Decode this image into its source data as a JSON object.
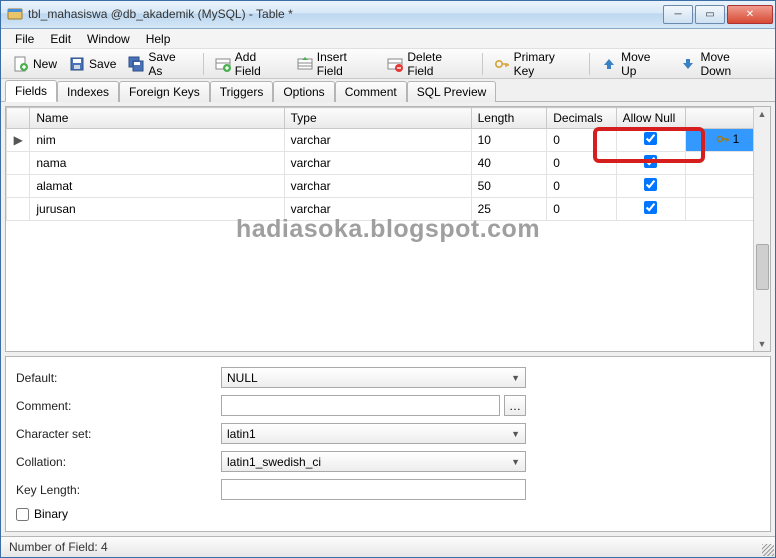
{
  "window": {
    "title": "tbl_mahasiswa @db_akademik (MySQL) - Table *"
  },
  "menu": {
    "file": "File",
    "edit": "Edit",
    "window": "Window",
    "help": "Help"
  },
  "toolbar": {
    "new": "New",
    "save": "Save",
    "saveas": "Save As",
    "addfield": "Add Field",
    "insertfield": "Insert Field",
    "deletefield": "Delete Field",
    "primarykey": "Primary Key",
    "moveup": "Move Up",
    "movedown": "Move Down"
  },
  "tabs": {
    "fields": "Fields",
    "indexes": "Indexes",
    "foreign": "Foreign Keys",
    "triggers": "Triggers",
    "options": "Options",
    "comment": "Comment",
    "sql": "SQL Preview"
  },
  "grid": {
    "headers": {
      "name": "Name",
      "type": "Type",
      "length": "Length",
      "decimals": "Decimals",
      "allownull": "Allow Null"
    },
    "rows": [
      {
        "name": "nim",
        "type": "varchar",
        "length": "10",
        "decimals": "0",
        "allow_null": true,
        "pk": "1",
        "current": true
      },
      {
        "name": "nama",
        "type": "varchar",
        "length": "40",
        "decimals": "0",
        "allow_null": true
      },
      {
        "name": "alamat",
        "type": "varchar",
        "length": "50",
        "decimals": "0",
        "allow_null": true
      },
      {
        "name": "jurusan",
        "type": "varchar",
        "length": "25",
        "decimals": "0",
        "allow_null": true
      }
    ]
  },
  "watermark": "hadiasoka.blogspot.com",
  "form": {
    "default_label": "Default:",
    "default_value": "NULL",
    "comment_label": "Comment:",
    "comment_value": "",
    "charset_label": "Character set:",
    "charset_value": "latin1",
    "collation_label": "Collation:",
    "collation_value": "latin1_swedish_ci",
    "keylen_label": "Key Length:",
    "keylen_value": "",
    "binary_label": "Binary"
  },
  "statusbar": {
    "text": "Number of Field: 4"
  }
}
